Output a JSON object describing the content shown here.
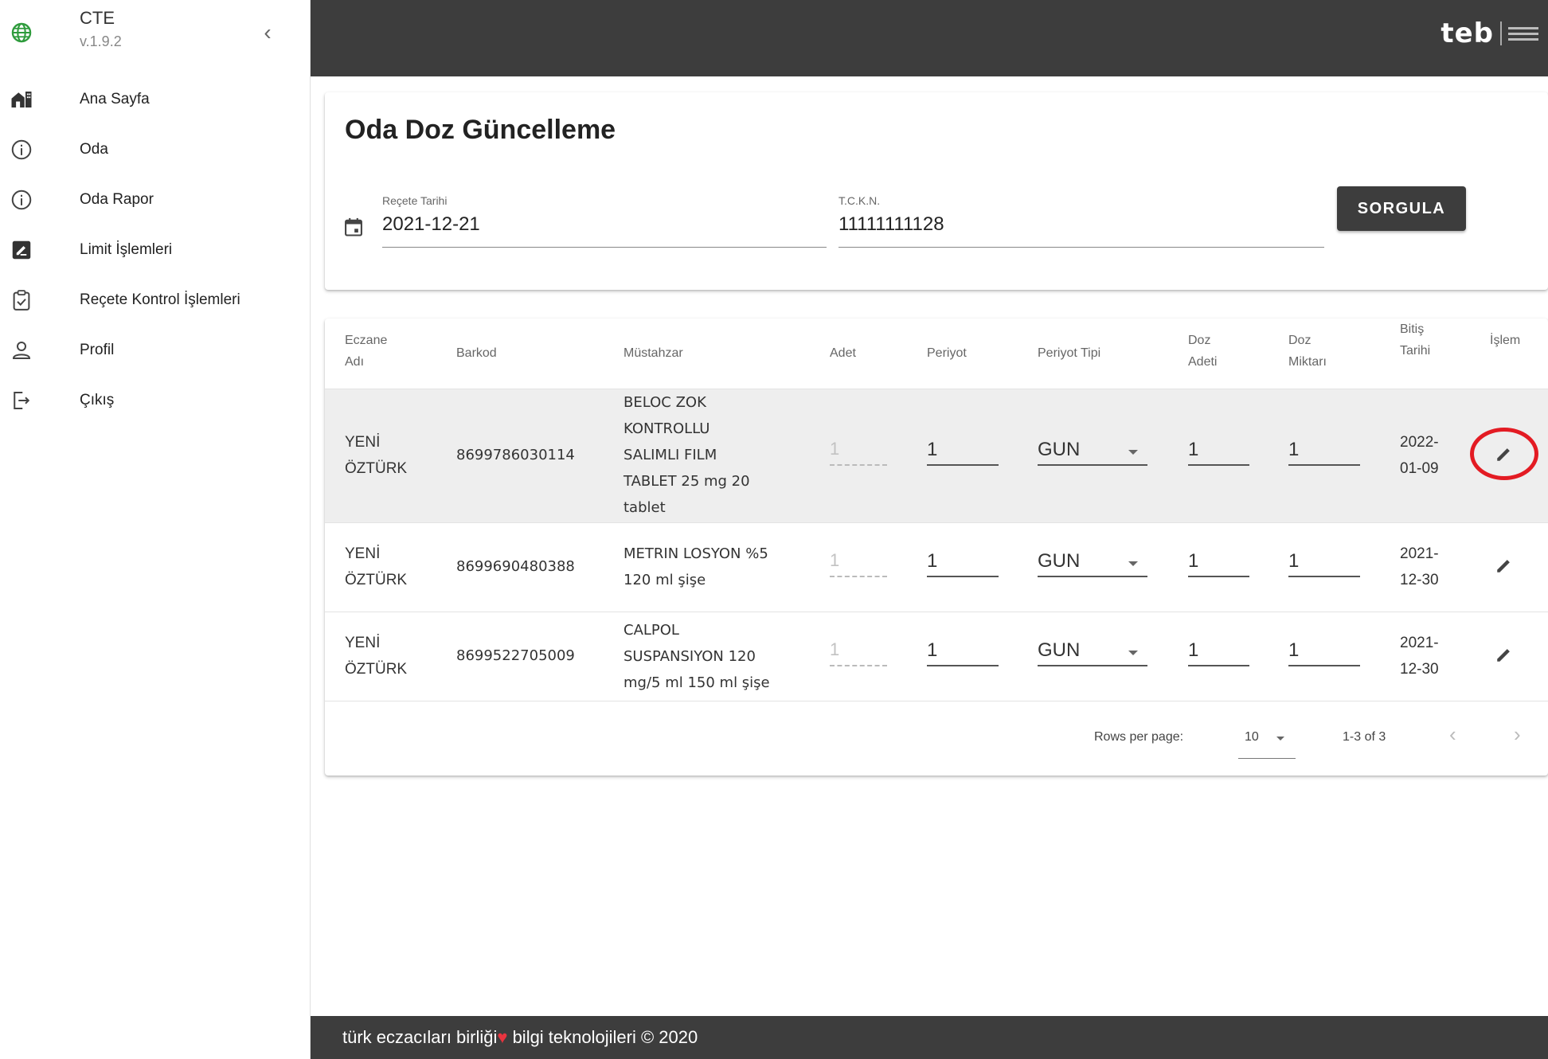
{
  "app": {
    "name": "CTE",
    "version": "v.1.9.2"
  },
  "sidebar": {
    "items": [
      {
        "label": "Ana Sayfa",
        "icon": "home-icon"
      },
      {
        "label": "Oda",
        "icon": "info-icon"
      },
      {
        "label": "Oda Rapor",
        "icon": "info-icon"
      },
      {
        "label": "Limit İşlemleri",
        "icon": "edit-box-icon"
      },
      {
        "label": "Reçete Kontrol İşlemleri",
        "icon": "clipboard-check-icon"
      },
      {
        "label": "Profil",
        "icon": "user-icon"
      },
      {
        "label": "Çıkış",
        "icon": "logout-icon"
      }
    ]
  },
  "header": {
    "logo_text": "teb"
  },
  "page": {
    "title": "Oda Doz Güncelleme",
    "recete_tarihi_label": "Reçete Tarihi",
    "recete_tarihi_value": "2021-12-21",
    "tckn_label": "T.C.K.N.",
    "tckn_value": "11111111128",
    "query_button": "SORGULA"
  },
  "table": {
    "headers": {
      "eczane_1": "Eczane",
      "eczane_2": "Adı",
      "barkod": "Barkod",
      "mustahzar": "Müstahzar",
      "adet": "Adet",
      "periyot": "Periyot",
      "periyot_tipi": "Periyot Tipi",
      "doz_adeti_1": "Doz",
      "doz_adeti_2": "Adeti",
      "doz_miktari_1": "Doz",
      "doz_miktari_2": "Miktarı",
      "bitis_1": "Bitiş",
      "bitis_2": "Tarihi",
      "islem": "İşlem"
    },
    "rows": [
      {
        "eczane_1": "YENİ",
        "eczane_2": "ÖZTÜRK",
        "barkod": "8699786030114",
        "mustahzar_lines": [
          "BELOC ZOK",
          "KONTROLLU",
          "SALIMLI FILM",
          "TABLET 25 mg 20",
          "tablet"
        ],
        "adet": "1",
        "periyot": "1",
        "periyot_tipi": "GUN",
        "doz_adeti": "1",
        "doz_miktari": "1",
        "bitis_1": "2022-",
        "bitis_2": "01-09",
        "highlighted": true
      },
      {
        "eczane_1": "YENİ",
        "eczane_2": "ÖZTÜRK",
        "barkod": "8699690480388",
        "mustahzar_lines": [
          "METRIN LOSYON %5",
          "120 ml şişe"
        ],
        "adet": "1",
        "periyot": "1",
        "periyot_tipi": "GUN",
        "doz_adeti": "1",
        "doz_miktari": "1",
        "bitis_1": "2021-",
        "bitis_2": "12-30",
        "highlighted": false
      },
      {
        "eczane_1": "YENİ",
        "eczane_2": "ÖZTÜRK",
        "barkod": "8699522705009",
        "mustahzar_lines": [
          "CALPOL",
          "SUSPANSIYON 120",
          "mg/5 ml 150 ml şişe"
        ],
        "adet": "1",
        "periyot": "1",
        "periyot_tipi": "GUN",
        "doz_adeti": "1",
        "doz_miktari": "1",
        "bitis_1": "2021-",
        "bitis_2": "12-30",
        "highlighted": false
      }
    ],
    "pagination": {
      "rows_per_page_label": "Rows per page:",
      "rows_per_page_value": "10",
      "range": "1-3 of 3"
    }
  },
  "footer": {
    "text_before": "türk eczacıları birliği",
    "heart": "♥",
    "text_after": " bilgi teknolojileri © 2020"
  },
  "colors": {
    "topbar": "#3d3d3d",
    "highlight_ring": "#e31b23",
    "heart": "#e8343f"
  }
}
